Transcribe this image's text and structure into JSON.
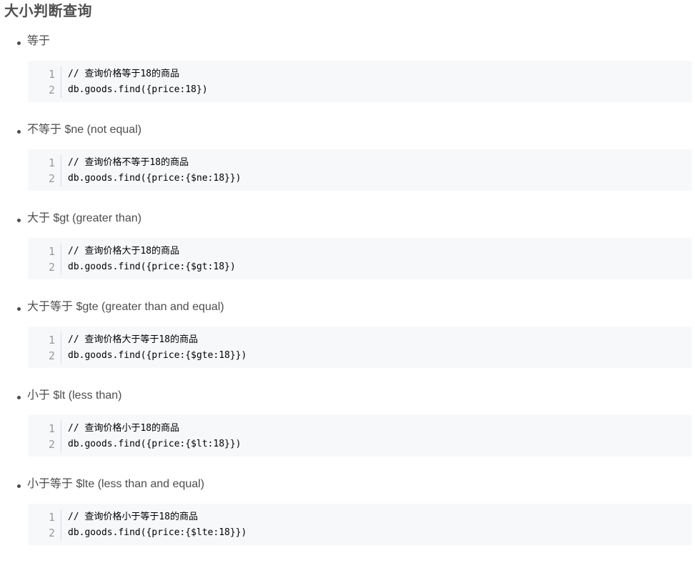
{
  "heading": "大小判断查询",
  "operators": [
    {
      "label": "等于",
      "line_numbers": [
        "1",
        "2"
      ],
      "code": [
        "// 查询价格等于18的商品",
        "db.goods.find({price:18})"
      ]
    },
    {
      "label": "不等于 $ne (not equal)",
      "line_numbers": [
        "1",
        "2"
      ],
      "code": [
        "// 查询价格不等于18的商品",
        "db.goods.find({price:{$ne:18}})"
      ]
    },
    {
      "label": "大于 $gt (greater than)",
      "line_numbers": [
        "1",
        "2"
      ],
      "code": [
        "// 查询价格大于18的商品",
        "db.goods.find({price:{$gt:18})"
      ]
    },
    {
      "label": "大于等于 $gte (greater than and equal)",
      "line_numbers": [
        "1",
        "2"
      ],
      "code": [
        "// 查询价格大于等于18的商品",
        "db.goods.find({price:{$gte:18}})"
      ]
    },
    {
      "label": "小于 $lt (less than)",
      "line_numbers": [
        "1",
        "2"
      ],
      "code": [
        "// 查询价格小于18的商品",
        "db.goods.find({price:{$lt:18}})"
      ]
    },
    {
      "label": "小于等于 $lte (less than and equal)",
      "line_numbers": [
        "1",
        "2"
      ],
      "code": [
        "// 查询价格小于等于18的商品",
        "db.goods.find({price:{$lte:18}})"
      ]
    }
  ],
  "colors": {
    "text": "#4d4d4d",
    "code_background": "#f6f8fa",
    "line_number": "#999999",
    "code_text": "#000000"
  }
}
